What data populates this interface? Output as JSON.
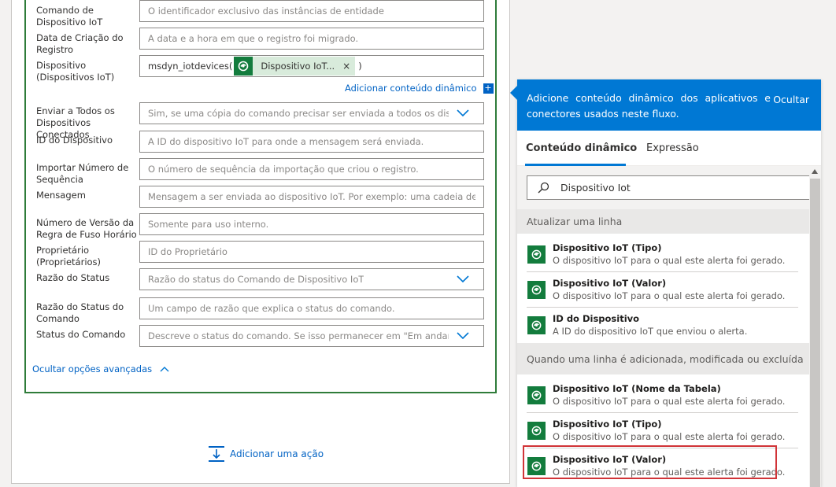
{
  "form": {
    "fields": [
      {
        "label": "Comando de Dispositivo IoT",
        "placeholder": "O identificador exclusivo das instâncias de entidade"
      },
      {
        "label": "Data de Criação do Registro",
        "placeholder": "A data e a hora em que o registro foi migrado."
      },
      {
        "label": "Dispositivo (Dispositivos IoT)",
        "prefix": "msdyn_iotdevices(",
        "token": "Dispositivo IoT...",
        "token_close": "×",
        "suffix": ")"
      },
      {
        "label": "Enviar a Todos os Dispositivos Conectados",
        "placeholder": "Sim, se uma cópia do comando precisar ser enviada a todos os dispositivos"
      },
      {
        "label": "ID do Dispositivo",
        "placeholder": "A ID do dispositivo IoT para onde a mensagem será enviada."
      },
      {
        "label": "Importar Número de Sequência",
        "placeholder": "O número de sequência da importação que criou o registro."
      },
      {
        "label": "Mensagem",
        "placeholder": "Mensagem a ser enviada ao dispositivo IoT. Por exemplo: uma cadeia de caracteres"
      },
      {
        "label": "Número de Versão da Regra de Fuso Horário",
        "placeholder": "Somente para uso interno."
      },
      {
        "label": "Proprietário (Proprietários)",
        "placeholder": "ID do Proprietário"
      },
      {
        "label": "Razão do Status",
        "placeholder": "Razão do status do Comando de Dispositivo IoT"
      },
      {
        "label": "Razão do Status do Comando",
        "placeholder": "Um campo de razão que explica o status do comando."
      },
      {
        "label": "Status do Comando",
        "placeholder": "Descreve o status do comando. Se isso permanecer em \"Em andamento\""
      }
    ],
    "add_dynamic_label": "Adicionar conteúdo dinâmico",
    "add_dynamic_plus": "+",
    "hide_advanced_label": "Ocultar opções avançadas"
  },
  "canvas": {
    "add_action_label": "Adicionar uma ação"
  },
  "dynamic_panel": {
    "description": "Adicione conteúdo dinâmico dos aplicativos e conectores usados neste fluxo.",
    "hide_label": "Ocultar",
    "tabs": [
      "Conteúdo dinâmico",
      "Expressão"
    ],
    "search_value": "Dispositivo Iot",
    "groups": [
      {
        "header": "Atualizar uma linha",
        "items": [
          {
            "title": "Dispositivo IoT (Tipo)",
            "desc": "O dispositivo IoT para o qual este alerta foi gerado."
          },
          {
            "title": "Dispositivo IoT (Valor)",
            "desc": "O dispositivo IoT para o qual este alerta foi gerado."
          },
          {
            "title": "ID do Dispositivo",
            "desc": "A ID do dispositivo IoT que enviou o alerta."
          }
        ]
      },
      {
        "header": "Quando uma linha é adicionada, modificada ou excluída",
        "items": [
          {
            "title": "Dispositivo IoT (Nome da Tabela)",
            "desc": "O dispositivo IoT para o qual este alerta foi gerado."
          },
          {
            "title": "Dispositivo IoT (Tipo)",
            "desc": "O dispositivo IoT para o qual este alerta foi gerado."
          },
          {
            "title": "Dispositivo IoT (Valor)",
            "desc": "O dispositivo IoT para o qual este alerta foi gerado."
          }
        ]
      }
    ]
  },
  "colors": {
    "accent": "#0078d4",
    "link": "#0062c4",
    "dataverse_green": "#137c3d",
    "highlight": "#d13438",
    "card_border": "#2f7c3a"
  }
}
